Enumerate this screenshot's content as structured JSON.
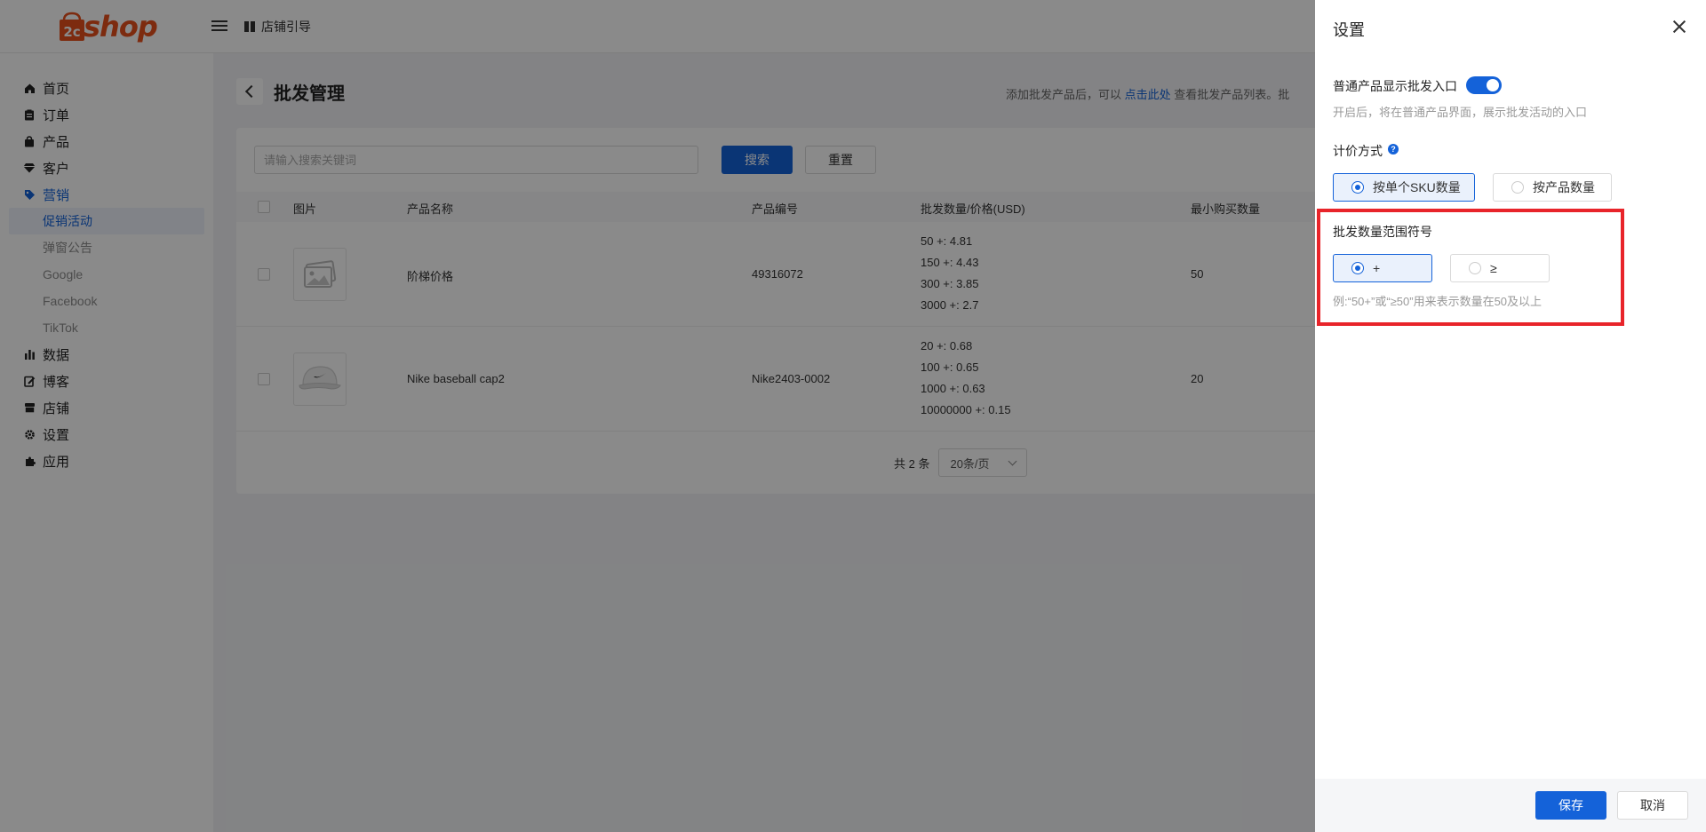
{
  "header": {
    "logo_prefix": "2c",
    "logo_text": "shop",
    "store_guide_label": "店铺引导"
  },
  "sidebar": {
    "items": [
      {
        "label": "首页",
        "icon": "home-icon"
      },
      {
        "label": "订单",
        "icon": "order-icon"
      },
      {
        "label": "产品",
        "icon": "product-icon"
      },
      {
        "label": "客户",
        "icon": "customer-icon"
      },
      {
        "label": "营销",
        "icon": "tag-icon"
      },
      {
        "label": "数据",
        "icon": "chart-icon"
      },
      {
        "label": "博客",
        "icon": "blog-icon"
      },
      {
        "label": "店铺",
        "icon": "store-icon"
      },
      {
        "label": "设置",
        "icon": "gear-icon"
      },
      {
        "label": "应用",
        "icon": "puzzle-icon"
      }
    ],
    "marketing_sub": [
      "促销活动",
      "弹窗公告",
      "Google",
      "Facebook",
      "TikTok"
    ]
  },
  "main": {
    "title": "批发管理",
    "hint_prefix": "添加批发产品后，可以",
    "hint_link": "点击此处",
    "hint_suffix": "查看批发产品列表。批",
    "search_placeholder": "请输入搜索关键词",
    "search_label": "搜索",
    "reset_label": "重置",
    "columns": [
      "图片",
      "产品名称",
      "产品编号",
      "批发数量/价格(USD)",
      "最小购买数量"
    ],
    "rows": [
      {
        "name": "阶梯价格",
        "code": "49316072",
        "prices": [
          "50 +: 4.81",
          "150 +: 4.43",
          "300 +: 3.85",
          "3000 +: 2.7"
        ],
        "min_qty": "50"
      },
      {
        "name": "Nike baseball cap2",
        "code": "Nike2403-0002",
        "prices": [
          "20 +: 0.68",
          "100 +: 0.65",
          "1000 +: 0.63",
          "10000000 +: 0.15"
        ],
        "min_qty": "20"
      }
    ],
    "total": "共 2 条",
    "page_size": "20条/页"
  },
  "drawer": {
    "title": "设置",
    "show_entry_label": "普通产品显示批发入口",
    "show_entry_desc": "开启后，将在普通产品界面，展示批发活动的入口",
    "pricing_label": "计价方式",
    "pricing_options": [
      "按单个SKU数量",
      "按产品数量"
    ],
    "symbol_label": "批发数量范围符号",
    "symbol_options": [
      "+",
      "≥"
    ],
    "symbol_desc": "例:“50+”或“≥50”用来表示数量在50及以上",
    "save_label": "保存",
    "cancel_label": "取消"
  },
  "colors": {
    "accent": "#1462d9",
    "logo": "#e8501d",
    "highlight": "#e8242a"
  }
}
